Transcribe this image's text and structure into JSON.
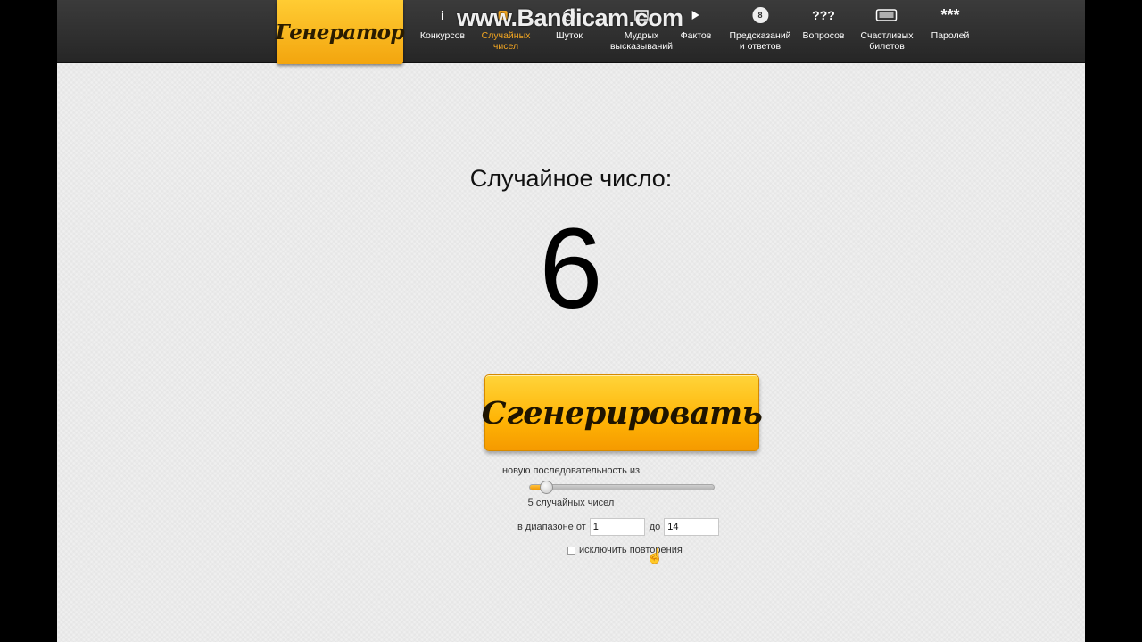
{
  "header": {
    "logo": "Генератор",
    "watermark": "www.Bandicam.com",
    "nav": [
      {
        "icon": "i",
        "line1": "Конкурсов",
        "line2": "",
        "active": false
      },
      {
        "icon": "",
        "line1": "Случайных",
        "line2": "чисел",
        "active": true
      },
      {
        "icon": "",
        "line1": "Шуток",
        "line2": "",
        "active": false
      },
      {
        "icon": "",
        "line1": "Мудрых",
        "line2": "высказываний",
        "active": false
      },
      {
        "icon": "",
        "line1": "Фактов",
        "line2": "",
        "active": false
      },
      {
        "icon": "8",
        "line1": "Предсказаний",
        "line2": "и ответов",
        "active": false
      },
      {
        "icon": "???",
        "line1": "Вопросов",
        "line2": "",
        "active": false
      },
      {
        "icon": "",
        "line1": "Счастливых",
        "line2": "билетов",
        "active": false
      },
      {
        "icon": "***",
        "line1": "Паролей",
        "line2": "",
        "active": false
      }
    ]
  },
  "result": {
    "title": "Случайное число:",
    "value": "6"
  },
  "generate_button": "Сгенерировать",
  "options": {
    "sequence_label": "новую последовательность из",
    "count_label": "5 случайных чисел",
    "slider_value": 0.05,
    "range_label": "в диапазоне от",
    "from_value": "1",
    "to_label": "до",
    "to_value": "14",
    "exclude_label": "исключить повторения"
  },
  "colors": {
    "accent": "#f6a821",
    "button": "#ffb405"
  }
}
